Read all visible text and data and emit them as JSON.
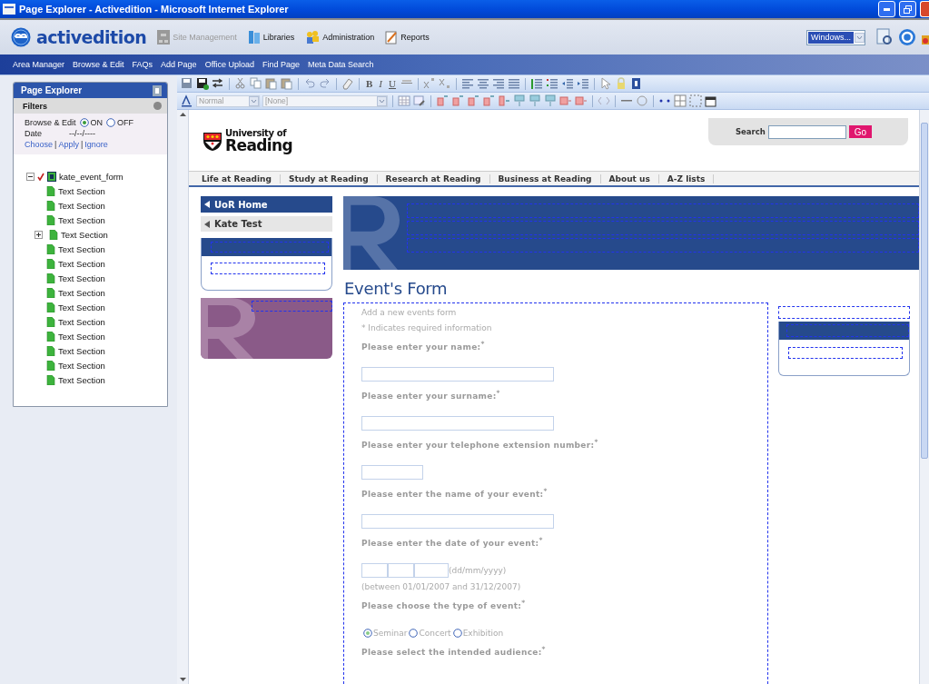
{
  "window": {
    "title": "Page Explorer - Activedition - Microsoft Internet Explorer"
  },
  "app_bar": {
    "logo": "activedition",
    "menu": [
      {
        "label": "Site Management",
        "disabled": true
      },
      {
        "label": "Libraries",
        "disabled": false
      },
      {
        "label": "Administration",
        "disabled": false
      },
      {
        "label": "Reports",
        "disabled": false
      }
    ],
    "window_select": "Windows..."
  },
  "nav": [
    "Area Manager",
    "Browse & Edit",
    "FAQs",
    "Add Page",
    "Office Upload",
    "Find Page",
    "Meta Data Search"
  ],
  "page_explorer": {
    "title": "Page Explorer",
    "filters_title": "Filters",
    "browse_edit_label": "Browse & Edit",
    "browse_edit_options": [
      {
        "label": "ON",
        "selected": true
      },
      {
        "label": "OFF",
        "selected": false
      }
    ],
    "date_label": "Date",
    "date_value": "--/--/----",
    "links": [
      {
        "kind": "link",
        "label": "Choose"
      },
      {
        "kind": "separator",
        "label": "|"
      },
      {
        "kind": "link",
        "label": "Apply"
      },
      {
        "kind": "separator",
        "label": "|"
      },
      {
        "kind": "link",
        "label": "Ignore"
      }
    ],
    "tree": {
      "label": "kate_event_form",
      "expanded": true,
      "checked": true,
      "children": [
        {
          "label": "Text Section",
          "collapsed": false
        },
        {
          "label": "Text Section",
          "collapsed": false
        },
        {
          "label": "Text Section",
          "collapsed": false
        },
        {
          "label": "Text Section",
          "collapsed": true
        },
        {
          "label": "Text Section",
          "collapsed": false
        },
        {
          "label": "Text Section",
          "collapsed": false
        },
        {
          "label": "Text Section",
          "collapsed": false
        },
        {
          "label": "Text Section",
          "collapsed": false
        },
        {
          "label": "Text Section",
          "collapsed": false
        },
        {
          "label": "Text Section",
          "collapsed": false
        },
        {
          "label": "Text Section",
          "collapsed": false
        },
        {
          "label": "Text Section",
          "collapsed": false
        },
        {
          "label": "Text Section",
          "collapsed": false
        },
        {
          "label": "Text Section",
          "collapsed": false
        }
      ]
    }
  },
  "editor_toolbar": {
    "format_buttons": [
      "B",
      "I",
      "U"
    ],
    "style_select": "Normal",
    "class_select": "[None]"
  },
  "site": {
    "logo_top": "University of",
    "logo_bottom": "Reading",
    "search_label": "Search",
    "search_button": "Go",
    "nav": [
      "Life at Reading",
      "Study at Reading",
      "Research at Reading",
      "Business at Reading",
      "About us",
      "A-Z lists"
    ],
    "side_menu": [
      {
        "label": "UoR Home",
        "selected": true
      },
      {
        "label": "Kate Test",
        "selected": false
      }
    ],
    "heading": "Event's Form",
    "form": {
      "intro": "Add a new events form",
      "required_note": "* Indicates required information",
      "questions": [
        {
          "kind": "text",
          "label": "Please enter your name:$^{*}$"
        },
        {
          "kind": "text",
          "label": "Please enter your surname:$^{*}$"
        },
        {
          "kind": "short",
          "label": "Please enter your telephone extension number:$^{*}$"
        },
        {
          "kind": "text",
          "label": "Please enter the name of your event:$^{*}$"
        },
        {
          "kind": "date",
          "label": "Please enter the date of your event:$^{*}$",
          "format": "(dd/mm/yyyy)",
          "range": "(between 01/01/2007 and 31/12/2007)"
        },
        {
          "kind": "radio",
          "label": "Please choose the type of event:$^{*}$",
          "options": [
            {
              "label": "Seminar",
              "selected": true
            },
            {
              "label": "Concert",
              "selected": false
            },
            {
              "label": "Exhibition",
              "selected": false
            }
          ]
        },
        {
          "kind": "label",
          "label": "Please select the intended audience:$^{*}$"
        }
      ]
    }
  }
}
